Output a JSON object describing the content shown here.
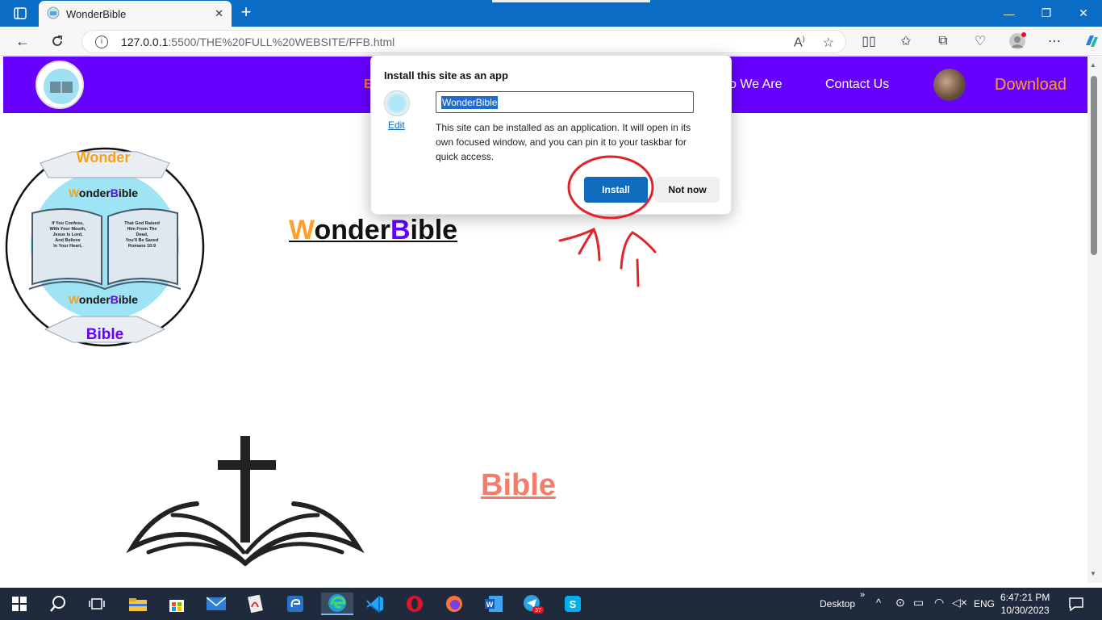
{
  "browser": {
    "tab_title": "WonderBible",
    "new_tab_symbol": "+",
    "url_host": "127.0.0.1",
    "url_path": ":5500/THE%20FULL%20WEBSITE/FFB.html",
    "window_controls": [
      "—",
      "❐",
      "✕"
    ]
  },
  "site": {
    "nav_partial": "E",
    "nav_links": [
      "o We Are",
      "Contact Us"
    ],
    "download": "Download",
    "hero_title_w": "W",
    "hero_title_mid": "onder",
    "hero_title_b": "B",
    "hero_title_end": "ible",
    "bible_link": "Bible",
    "logo_top": "Wonder",
    "logo_inner_top_w": "W",
    "logo_inner_top_mid": "onder",
    "logo_inner_top_b": "B",
    "logo_inner_top_end": "ible",
    "logo_inner_bottom_w": "W",
    "logo_inner_bottom_mid": "onder",
    "logo_inner_bottom_b": "B",
    "logo_inner_bottom_end": "ible",
    "logo_bottom": "Bible",
    "book_left_text": [
      "If You Confess,",
      "With Your Mouth,",
      "Jesus Is Lord,",
      "And Believe",
      "In Your Heart,"
    ],
    "book_right_text": [
      "That God Raised",
      "Him From The",
      "Dead,",
      "You'll Be Saved",
      "Romans 10:9"
    ]
  },
  "dialog": {
    "title": "Install this site as an app",
    "edit": "Edit",
    "app_name": "WonderBible",
    "description": "This site can be installed as an application. It will open in its own focused window, and you can pin it to your taskbar for quick access.",
    "install": "Install",
    "not_now": "Not now"
  },
  "taskbar": {
    "desktop_label": "Desktop",
    "language": "ENG",
    "time": "6:47:21 PM",
    "date": "10/30/2023",
    "telegram_badge": "37"
  },
  "colors": {
    "nav_purple": "#6600ff",
    "accent_orange": "#ff9f2a",
    "bible_salmon": "#f47c68",
    "install_blue": "#0f6cbd",
    "annotation_red": "#e0242a"
  }
}
